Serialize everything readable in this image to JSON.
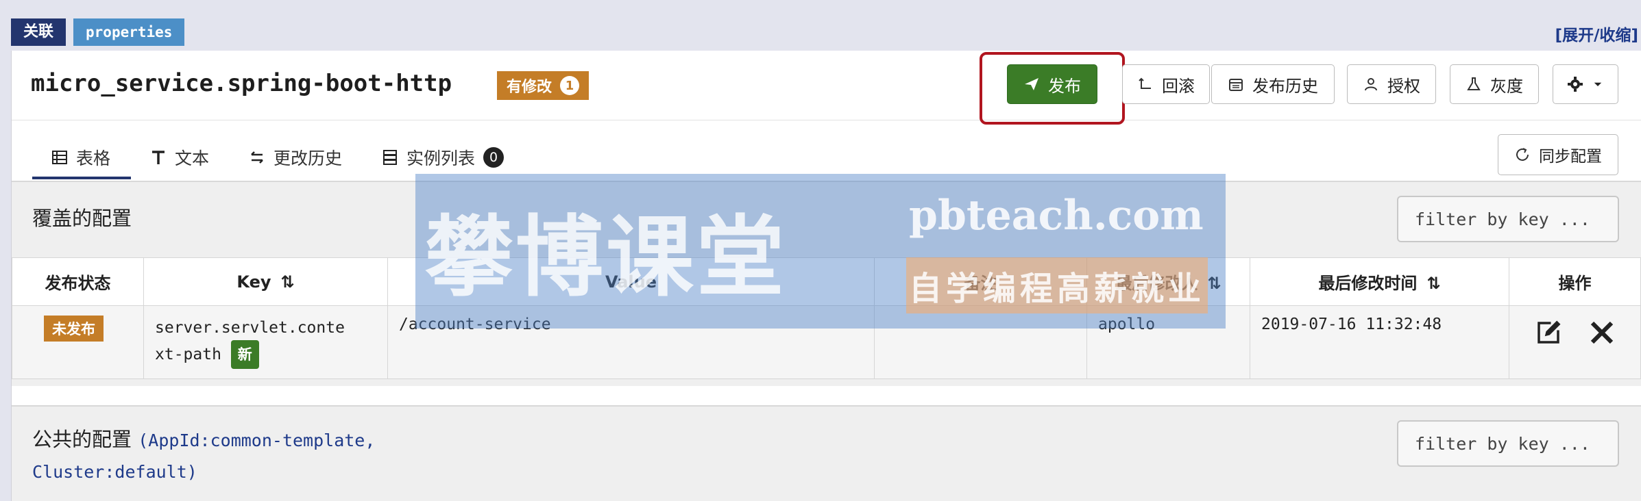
{
  "tags": {
    "assoc": "关联",
    "format": "properties"
  },
  "toggle_link": "[展开/收缩]",
  "namespace": {
    "name": "micro_service.spring-boot-http",
    "modified_label": "有修改",
    "modified_count": "1"
  },
  "toolbar": {
    "publish": "发布",
    "rollback": "回滚",
    "history": "发布历史",
    "auth": "授权",
    "gray": "灰度"
  },
  "tabs": [
    {
      "label": "表格",
      "icon": "table-icon"
    },
    {
      "label": "文本",
      "icon": "text-icon"
    },
    {
      "label": "更改历史",
      "icon": "exchange-icon"
    },
    {
      "label": "实例列表",
      "icon": "server-icon",
      "count": "0"
    }
  ],
  "sync_button": "同步配置",
  "override_section": {
    "title": "覆盖的配置",
    "filter_placeholder": "filter by key ...",
    "columns": [
      "发布状态",
      "Key",
      "Value",
      "备注",
      "最后修改人",
      "最后修改时间",
      "操作"
    ],
    "rows": [
      {
        "status": "未发布",
        "key_line1": "server.servlet.conte",
        "key_line2": "xt-path",
        "new_tag": "新",
        "value": "/account-service",
        "comment": "",
        "modifier": "apollo",
        "modified_time": "2019-07-16 11:32:48"
      }
    ]
  },
  "public_section": {
    "title": "公共的配置",
    "appid_line1": "(AppId:common-template,",
    "appid_line2": "Cluster:default)",
    "filter_placeholder": "filter by key ..."
  },
  "watermark": {
    "brand": "攀博课堂",
    "url": "pbteach.com",
    "slogan": "自学编程高薪就业"
  },
  "colors": {
    "dark_blue": "#23356e",
    "blue": "#4c8fc7",
    "orange": "#c47d27",
    "green": "#3b7c27",
    "highlight_red": "#b1151f"
  }
}
